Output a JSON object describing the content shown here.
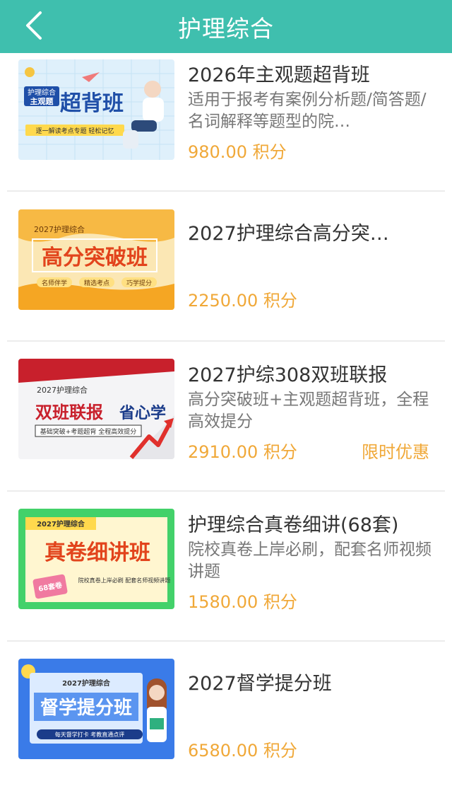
{
  "header": {
    "title": "护理综合",
    "back_icon": "chevron-left-icon"
  },
  "products": [
    {
      "title": "2026年主观题超背班",
      "description": "适用于报考有案例分析题/简答题/名词解释等题型的院…",
      "price": "980.00 积分",
      "tag": "",
      "thumb": {
        "line1": "护理综合",
        "line2": "主观题",
        "big": "超背班",
        "banner": "逐一解读考点专题 轻松记忆"
      }
    },
    {
      "title": "2027护理综合高分突…",
      "description": "",
      "price": "2250.00 积分",
      "tag": "",
      "thumb": {
        "line1": "2027护理综合",
        "big": "高分突破班",
        "pill1": "名师伴学",
        "pill2": "精选考点",
        "pill3": "巧学提分"
      }
    },
    {
      "title": "2027护综308双班联报",
      "description": "高分突破班+主观题超背班，全程高效提分",
      "price": "2910.00 积分",
      "tag": "限时优惠",
      "thumb": {
        "line1": "2027护理综合",
        "big1": "双班联报",
        "big2": "省心学",
        "banner": "基础突破+考题超背 全程高效提分"
      }
    },
    {
      "title": "护理综合真卷细讲(68套)",
      "description": "院校真卷上岸必刷，配套名师视频讲题",
      "price": "1580.00 积分",
      "tag": "",
      "thumb": {
        "line1": "2027护理综合",
        "big": "真卷细讲班",
        "badge": "68套卷",
        "banner": "院校真卷上岸必刷 配套名师视频讲题"
      }
    },
    {
      "title": "2027督学提分班",
      "description": "",
      "price": "6580.00 积分",
      "tag": "",
      "thumb": {
        "line1": "2027护理综合",
        "big": "督学提分班",
        "banner": "每天督学打卡 考教直通点评"
      }
    }
  ]
}
